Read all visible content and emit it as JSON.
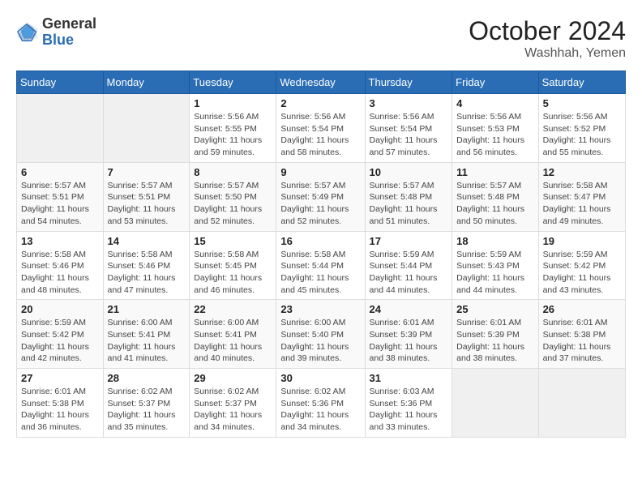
{
  "logo": {
    "general": "General",
    "blue": "Blue"
  },
  "header": {
    "month": "October 2024",
    "location": "Washhah, Yemen"
  },
  "weekdays": [
    "Sunday",
    "Monday",
    "Tuesday",
    "Wednesday",
    "Thursday",
    "Friday",
    "Saturday"
  ],
  "weeks": [
    [
      {
        "day": "",
        "info": ""
      },
      {
        "day": "",
        "info": ""
      },
      {
        "day": "1",
        "info": "Sunrise: 5:56 AM\nSunset: 5:55 PM\nDaylight: 11 hours and 59 minutes."
      },
      {
        "day": "2",
        "info": "Sunrise: 5:56 AM\nSunset: 5:54 PM\nDaylight: 11 hours and 58 minutes."
      },
      {
        "day": "3",
        "info": "Sunrise: 5:56 AM\nSunset: 5:54 PM\nDaylight: 11 hours and 57 minutes."
      },
      {
        "day": "4",
        "info": "Sunrise: 5:56 AM\nSunset: 5:53 PM\nDaylight: 11 hours and 56 minutes."
      },
      {
        "day": "5",
        "info": "Sunrise: 5:56 AM\nSunset: 5:52 PM\nDaylight: 11 hours and 55 minutes."
      }
    ],
    [
      {
        "day": "6",
        "info": "Sunrise: 5:57 AM\nSunset: 5:51 PM\nDaylight: 11 hours and 54 minutes."
      },
      {
        "day": "7",
        "info": "Sunrise: 5:57 AM\nSunset: 5:51 PM\nDaylight: 11 hours and 53 minutes."
      },
      {
        "day": "8",
        "info": "Sunrise: 5:57 AM\nSunset: 5:50 PM\nDaylight: 11 hours and 52 minutes."
      },
      {
        "day": "9",
        "info": "Sunrise: 5:57 AM\nSunset: 5:49 PM\nDaylight: 11 hours and 52 minutes."
      },
      {
        "day": "10",
        "info": "Sunrise: 5:57 AM\nSunset: 5:48 PM\nDaylight: 11 hours and 51 minutes."
      },
      {
        "day": "11",
        "info": "Sunrise: 5:57 AM\nSunset: 5:48 PM\nDaylight: 11 hours and 50 minutes."
      },
      {
        "day": "12",
        "info": "Sunrise: 5:58 AM\nSunset: 5:47 PM\nDaylight: 11 hours and 49 minutes."
      }
    ],
    [
      {
        "day": "13",
        "info": "Sunrise: 5:58 AM\nSunset: 5:46 PM\nDaylight: 11 hours and 48 minutes."
      },
      {
        "day": "14",
        "info": "Sunrise: 5:58 AM\nSunset: 5:46 PM\nDaylight: 11 hours and 47 minutes."
      },
      {
        "day": "15",
        "info": "Sunrise: 5:58 AM\nSunset: 5:45 PM\nDaylight: 11 hours and 46 minutes."
      },
      {
        "day": "16",
        "info": "Sunrise: 5:58 AM\nSunset: 5:44 PM\nDaylight: 11 hours and 45 minutes."
      },
      {
        "day": "17",
        "info": "Sunrise: 5:59 AM\nSunset: 5:44 PM\nDaylight: 11 hours and 44 minutes."
      },
      {
        "day": "18",
        "info": "Sunrise: 5:59 AM\nSunset: 5:43 PM\nDaylight: 11 hours and 44 minutes."
      },
      {
        "day": "19",
        "info": "Sunrise: 5:59 AM\nSunset: 5:42 PM\nDaylight: 11 hours and 43 minutes."
      }
    ],
    [
      {
        "day": "20",
        "info": "Sunrise: 5:59 AM\nSunset: 5:42 PM\nDaylight: 11 hours and 42 minutes."
      },
      {
        "day": "21",
        "info": "Sunrise: 6:00 AM\nSunset: 5:41 PM\nDaylight: 11 hours and 41 minutes."
      },
      {
        "day": "22",
        "info": "Sunrise: 6:00 AM\nSunset: 5:41 PM\nDaylight: 11 hours and 40 minutes."
      },
      {
        "day": "23",
        "info": "Sunrise: 6:00 AM\nSunset: 5:40 PM\nDaylight: 11 hours and 39 minutes."
      },
      {
        "day": "24",
        "info": "Sunrise: 6:01 AM\nSunset: 5:39 PM\nDaylight: 11 hours and 38 minutes."
      },
      {
        "day": "25",
        "info": "Sunrise: 6:01 AM\nSunset: 5:39 PM\nDaylight: 11 hours and 38 minutes."
      },
      {
        "day": "26",
        "info": "Sunrise: 6:01 AM\nSunset: 5:38 PM\nDaylight: 11 hours and 37 minutes."
      }
    ],
    [
      {
        "day": "27",
        "info": "Sunrise: 6:01 AM\nSunset: 5:38 PM\nDaylight: 11 hours and 36 minutes."
      },
      {
        "day": "28",
        "info": "Sunrise: 6:02 AM\nSunset: 5:37 PM\nDaylight: 11 hours and 35 minutes."
      },
      {
        "day": "29",
        "info": "Sunrise: 6:02 AM\nSunset: 5:37 PM\nDaylight: 11 hours and 34 minutes."
      },
      {
        "day": "30",
        "info": "Sunrise: 6:02 AM\nSunset: 5:36 PM\nDaylight: 11 hours and 34 minutes."
      },
      {
        "day": "31",
        "info": "Sunrise: 6:03 AM\nSunset: 5:36 PM\nDaylight: 11 hours and 33 minutes."
      },
      {
        "day": "",
        "info": ""
      },
      {
        "day": "",
        "info": ""
      }
    ]
  ]
}
